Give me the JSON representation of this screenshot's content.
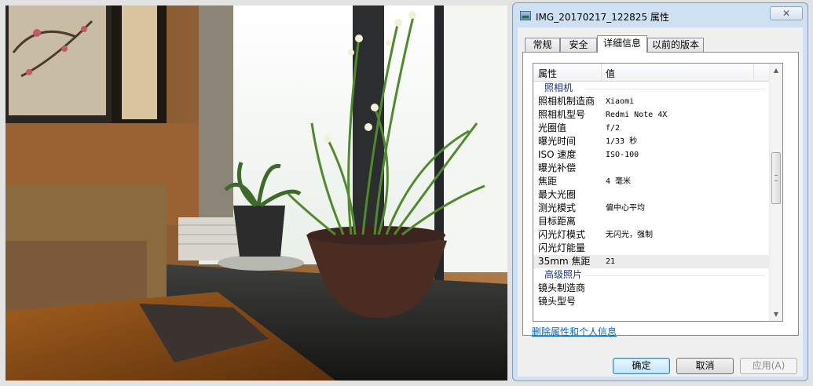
{
  "dialog": {
    "title": "IMG_20170217_122825 属性",
    "close_symbol": "✕",
    "tabs": [
      {
        "label": "常规",
        "active": false
      },
      {
        "label": "安全",
        "active": false
      },
      {
        "label": "详细信息",
        "active": true
      },
      {
        "label": "以前的版本",
        "active": false
      }
    ],
    "columns": {
      "property": "属性",
      "value": "值"
    },
    "rows": [
      {
        "type": "group",
        "key": "照相机",
        "value": ""
      },
      {
        "type": "item",
        "key": "照相机制造商",
        "value": "Xiaomi"
      },
      {
        "type": "item",
        "key": "照相机型号",
        "value": "Redmi Note 4X"
      },
      {
        "type": "item",
        "key": "光圈值",
        "value": "f/2"
      },
      {
        "type": "item",
        "key": "曝光时间",
        "value": "1/33 秒"
      },
      {
        "type": "item",
        "key": "ISO 速度",
        "value": "ISO-100"
      },
      {
        "type": "item",
        "key": "曝光补偿",
        "value": ""
      },
      {
        "type": "item",
        "key": "焦距",
        "value": "4 毫米"
      },
      {
        "type": "item",
        "key": "最大光圈",
        "value": ""
      },
      {
        "type": "item",
        "key": "测光模式",
        "value": "偏中心平均"
      },
      {
        "type": "item",
        "key": "目标距离",
        "value": ""
      },
      {
        "type": "item",
        "key": "闪光灯模式",
        "value": "无闪光，强制"
      },
      {
        "type": "item",
        "key": "闪光灯能量",
        "value": ""
      },
      {
        "type": "item",
        "key": "35mm 焦距",
        "value": "21",
        "selected": true
      },
      {
        "type": "group",
        "key": "高级照片",
        "value": ""
      },
      {
        "type": "item",
        "key": "镜头制造商",
        "value": ""
      },
      {
        "type": "item",
        "key": "镜头型号",
        "value": ""
      }
    ],
    "remove_link": "删除属性和个人信息",
    "buttons": {
      "ok": "确定",
      "cancel": "取消",
      "apply": "应用(A)"
    },
    "icons": {
      "title": "image-file-icon",
      "scroll_up": "scroll-up-arrow-icon",
      "scroll_down": "scroll-down-arrow-icon"
    }
  }
}
